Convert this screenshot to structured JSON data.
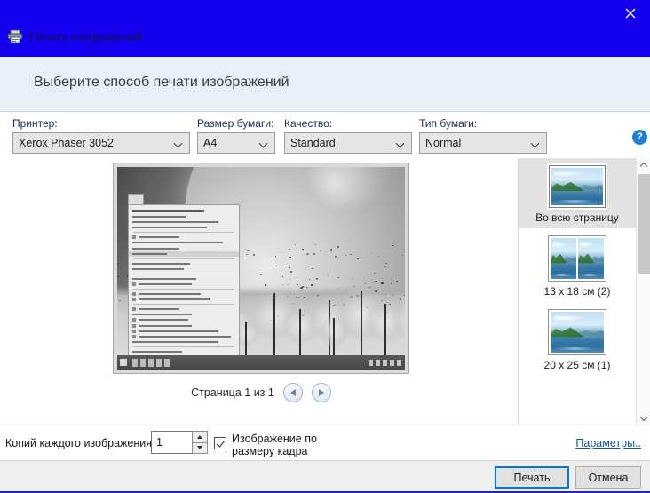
{
  "window": {
    "title": "Печать изображений",
    "title_icon": "printer-icon",
    "close_icon": "close-icon",
    "accent_color": "#1400ec"
  },
  "header": {
    "heading": "Выберите способ печати изображений",
    "band_color": "#e9eff7"
  },
  "fields": {
    "printer": {
      "label": "Принтер:",
      "value": "Xerox Phaser 3052"
    },
    "paper_size": {
      "label": "Размер бумаги:",
      "value": "A4"
    },
    "quality": {
      "label": "Качество:",
      "value": "Standard"
    },
    "paper_type": {
      "label": "Тип бумаги:",
      "value": "Normal"
    },
    "help_icon": "help-icon",
    "help_glyph": "?"
  },
  "preview": {
    "page_label": "Страница 1 из 1",
    "prev_icon": "arrow-left-icon",
    "next_icon": "arrow-right-icon"
  },
  "layouts": {
    "items": [
      {
        "label": "Во всю страницу",
        "selected": true,
        "panes": 1
      },
      {
        "label": "13 x 18 см (2)",
        "selected": false,
        "panes": 2
      },
      {
        "label": "20 x 25 см (1)",
        "selected": false,
        "panes": 1
      }
    ],
    "scroll_up_icon": "chevron-up-icon",
    "scroll_down_icon": "chevron-down-icon"
  },
  "options": {
    "copies_label": "Копий каждого изображения:",
    "copies_value": "1",
    "copies_placeholder": "1",
    "fit_label_line1": "Изображение по",
    "fit_label_line2": "размеру кадра",
    "fit_checked": true,
    "params_link": "Параметры.."
  },
  "footer": {
    "print_label": "Печать",
    "cancel_label": "Отмена",
    "focus_color": "#0078d7"
  }
}
